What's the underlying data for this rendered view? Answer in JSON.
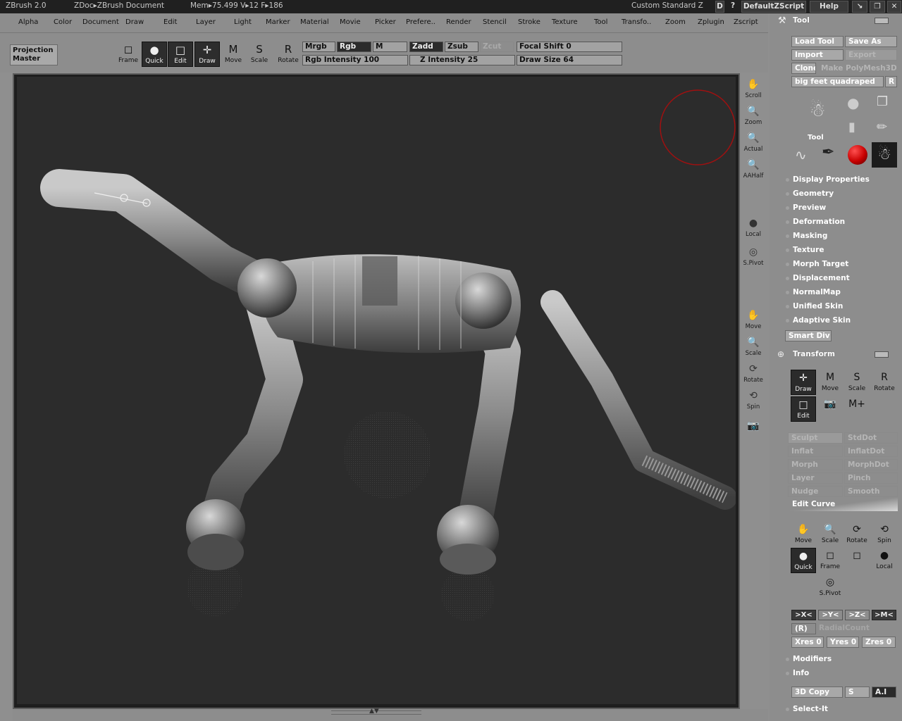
{
  "titlebar": {
    "app": "ZBrush 2.0",
    "doc": "ZDoc▸ZBrush Document",
    "stats": "Mem▸75.499 V▸12 F▸186",
    "layout": "Custom Standard Z",
    "layout_btn": "D",
    "help_q": "?",
    "script": "DefaultZScript",
    "help": "Help"
  },
  "menu": [
    "Alpha",
    "Color",
    "Document",
    "Draw",
    "Edit",
    "Layer",
    "Light",
    "Marker",
    "Material",
    "Movie",
    "Picker",
    "Prefere..",
    "Render",
    "Stencil",
    "Stroke",
    "Texture",
    "Tool",
    "Transfo..",
    "Zoom",
    "Zplugin",
    "Zscript"
  ],
  "toolbar": {
    "projection_master": "Projection Master",
    "frame": "Frame",
    "quick": "Quick",
    "edit": "Edit",
    "draw": "Draw",
    "move": "Move",
    "scale": "Scale",
    "rotate": "Rotate",
    "mrgb": "Mrgb",
    "rgb": "Rgb",
    "m": "M",
    "zadd": "Zadd",
    "zsub": "Zsub",
    "zcut": "Zcut",
    "focal_shift": "Focal Shift",
    "focal_shift_val": "0",
    "rgb_intensity": "Rgb Intensity",
    "rgb_intensity_val": "100",
    "z_intensity": "Z Intensity",
    "z_intensity_val": "25",
    "draw_size": "Draw Size",
    "draw_size_val": "64"
  },
  "viewport_buttons": {
    "scroll": "Scroll",
    "zoom": "Zoom",
    "actual": "Actual",
    "aahalf": "AAHalf",
    "local": "Local",
    "spivot": "S.Pivot",
    "move": "Move",
    "scale": "Scale",
    "rotate": "Rotate",
    "spin": "Spin"
  },
  "tool_panel": {
    "title": "Tool",
    "load_tool": "Load Tool",
    "save_as": "Save As",
    "import": "Import",
    "export": "Export",
    "clone": "Clone",
    "make_poly": "Make PolyMesh3D",
    "current_tool": "big feet quadraped",
    "r": "R",
    "tool_label": "Tool",
    "sections": [
      "Display Properties",
      "Geometry",
      "Preview",
      "Deformation",
      "Masking",
      "Texture",
      "Morph Target",
      "Displacement",
      "NormalMap",
      "Unified Skin",
      "Adaptive Skin"
    ],
    "smart_div": "Smart Div",
    "transform": "Transform",
    "t_draw": "Draw",
    "t_move": "Move",
    "t_scale": "Scale",
    "t_rotate": "Rotate",
    "t_edit": "Edit",
    "grid_left": [
      "Sculpt",
      "Inflat",
      "Morph",
      "Layer",
      "Nudge"
    ],
    "grid_right": [
      "StdDot",
      "InflatDot",
      "MorphDot",
      "Pinch",
      "Smooth"
    ],
    "edit_curve": "Edit Curve",
    "c_move": "Move",
    "c_scale": "Scale",
    "c_rotate": "Rotate",
    "c_spin": "Spin",
    "c_quick": "Quick",
    "c_frame": "Frame",
    "c_local": "Local",
    "c_spivot": "S.Pivot",
    "ax_x": ">X<",
    "ax_y": ">Y<",
    "ax_z": ">Z<",
    "ax_m": ">M<",
    "r_btn": "(R)",
    "radial_count": "RadialCount",
    "xres": "Xres",
    "xres_val": "0",
    "yres": "Yres",
    "yres_val": "0",
    "zres": "Zres",
    "zres_val": "0",
    "modifiers": "Modifiers",
    "info": "Info",
    "copy3d": "3D Copy",
    "s": "S",
    "ai": "A.I",
    "select_it": "Select-It"
  },
  "colors": {
    "accent_red": "#c80000",
    "bg_panel": "#8d8d8d",
    "canvas": "#2c2c2c"
  }
}
